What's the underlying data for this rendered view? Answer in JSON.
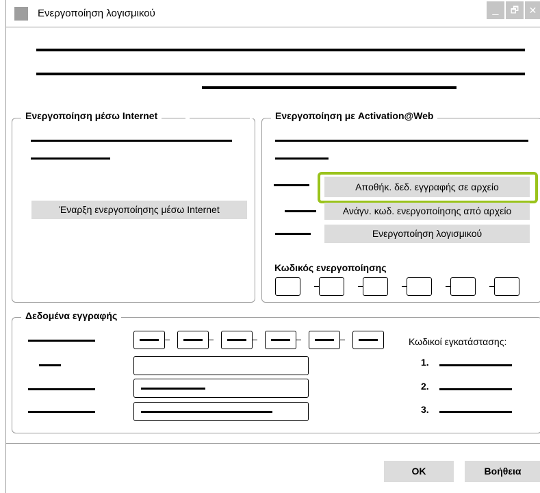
{
  "window": {
    "title": "Ενεργοποίηση λογισμικού",
    "controls": {
      "minimize": "_",
      "restore": "🗗",
      "close": "✕"
    }
  },
  "internet_group": {
    "title": "Ενεργοποίηση μέσω Internet",
    "start_button": "Έναρξη ενεργοποίησης μέσω Internet"
  },
  "web_group": {
    "title": "Ενεργοποίηση με Activation@Web",
    "save_button": "Αποθήκ. δεδ. εγγραφής σε αρχείο",
    "read_button": "Ανάγν. κωδ. ενεργοποίησης από αρχείο",
    "activate_button": "Ενεργοποίηση λογισμικού",
    "code_label": "Κωδικός ενεργοποίησης"
  },
  "registration_group": {
    "title": "Δεδομένα εγγραφής",
    "install_codes_label": "Κωδικοί εγκατάστασης:",
    "install_items": [
      "1.",
      "2.",
      "3."
    ]
  },
  "footer": {
    "ok_button": "OK",
    "help_button": "Βοήθεια"
  },
  "colors": {
    "highlight": "#9ac31c",
    "button": "#dcdcdc",
    "border": "#9a9a9a"
  }
}
